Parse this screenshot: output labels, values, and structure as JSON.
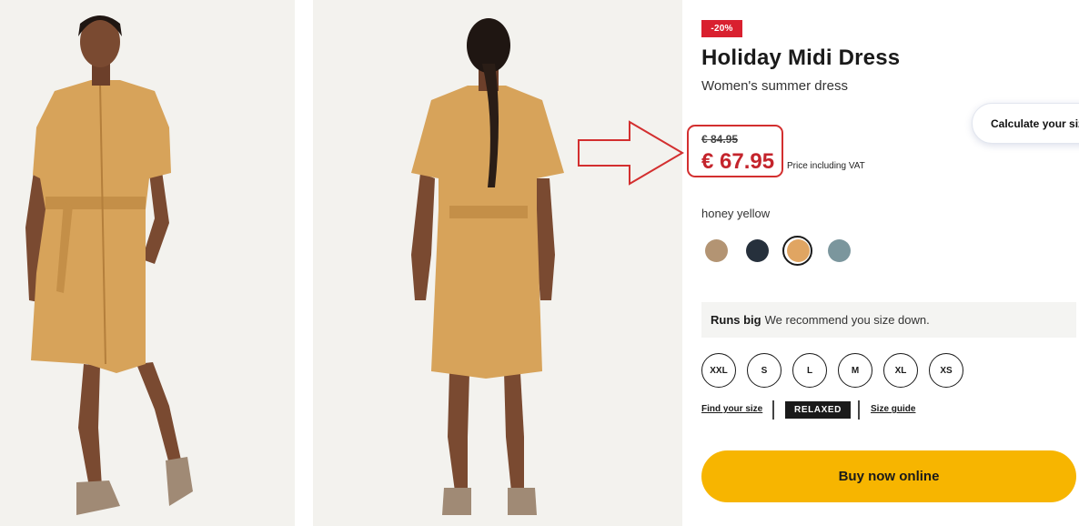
{
  "product": {
    "discount_badge": "-20%",
    "title": "Holiday Midi Dress",
    "subtitle": "Women's summer dress",
    "old_price": "€ 84.95",
    "sale_price": "€ 67.95",
    "vat_note": "Price including VAT",
    "calculate_size": "Calculate your size"
  },
  "colors": {
    "selected_name": "honey yellow",
    "swatches": [
      {
        "name": "sand",
        "hex": "#b39473"
      },
      {
        "name": "night blue",
        "hex": "#26303c"
      },
      {
        "name": "honey yellow",
        "hex": "#e0a562",
        "selected": true
      },
      {
        "name": "grey blue",
        "hex": "#7b969d"
      }
    ]
  },
  "fit_banner": {
    "title": "Runs big",
    "text": "We recommend you size down."
  },
  "sizes": [
    "XXL",
    "S",
    "L",
    "M",
    "XL",
    "XS"
  ],
  "size_links": {
    "find_size": "Find your size",
    "fit_tag": "RELAXED",
    "size_guide": "Size guide"
  },
  "buy_button": "Buy now online",
  "theme": {
    "accent_yellow": "#f7b500",
    "sale_red": "#c4242c",
    "badge_red": "#d9202f",
    "dress_color": "#d7a35a"
  },
  "annotation": {
    "icon": "right-arrow-icon",
    "color": "#d32f2f"
  }
}
